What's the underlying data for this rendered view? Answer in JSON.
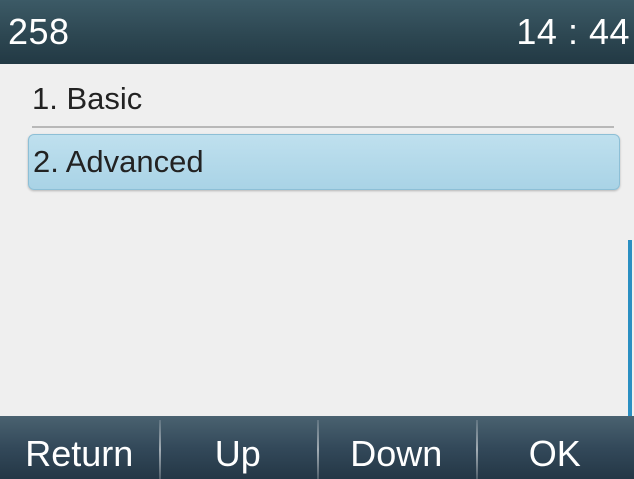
{
  "status_bar": {
    "account": "258",
    "time": "14 : 44"
  },
  "menu": {
    "items": [
      {
        "label": "1. Basic",
        "selected": false
      },
      {
        "label": "2. Advanced",
        "selected": true
      }
    ]
  },
  "softkeys": {
    "return_label": "Return",
    "up_label": "Up",
    "down_label": "Down",
    "ok_label": "OK"
  },
  "colors": {
    "status_bar_bg": "#2d4752",
    "selection_bg": "#a9d3e6",
    "scroll_thumb": "#2a8fc2",
    "softkey_bg": "#33495a",
    "list_bg": "#efefef"
  }
}
